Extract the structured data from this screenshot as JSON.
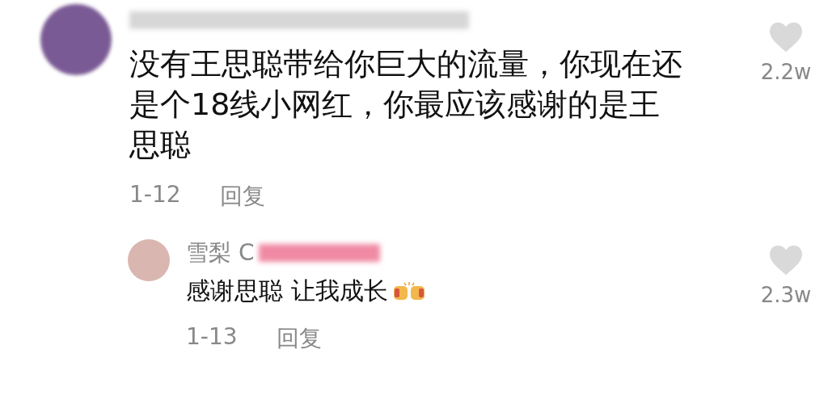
{
  "comments": [
    {
      "text": "没有王思聪带给你巨大的流量，你现在还是个18线小网红，你最应该感谢的是王思聪",
      "date": "1-12",
      "reply_label": "回复",
      "likes": "2.2w",
      "liked": false,
      "replies": [
        {
          "author": "雪梨 C",
          "text": "感谢思聪 让我成长",
          "date": "1-13",
          "reply_label": "回复",
          "likes": "2.3w",
          "liked": false
        }
      ]
    }
  ]
}
